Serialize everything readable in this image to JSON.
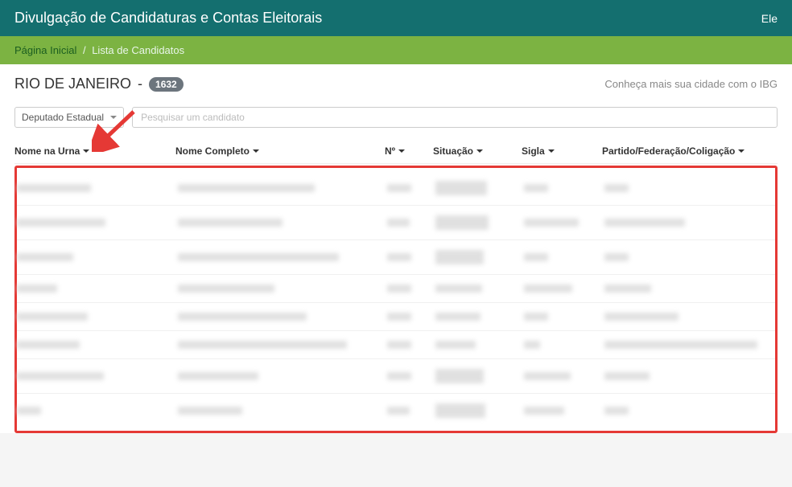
{
  "header": {
    "title": "Divulgação de Candidaturas e Contas Eleitorais",
    "right_link": "Ele"
  },
  "breadcrumb": {
    "home": "Página Inicial",
    "current": "Lista de Candidatos"
  },
  "region": {
    "name": "RIO DE JANEIRO",
    "dash": "-",
    "count": "1632"
  },
  "ibge_text": "Conheça mais sua cidade com o IBG",
  "filters": {
    "position_select": "Deputado Estadual",
    "search_placeholder": "Pesquisar um candidato"
  },
  "columns": {
    "nome_urna": "Nome na Urna",
    "nome_completo": "Nome Completo",
    "numero": "Nº",
    "situacao": "Situação",
    "sigla": "Sigla",
    "partido": "Partido/Federação/Coligação"
  },
  "rows": [
    {
      "w1": 92,
      "w2": 170,
      "w3": 30,
      "w4": 64,
      "w4h": "tall",
      "w5": 30,
      "w6": 30
    },
    {
      "w1": 110,
      "w2": 130,
      "w3": 28,
      "w4": 66,
      "w4h": "tall",
      "w5": 68,
      "w6": 100
    },
    {
      "w1": 70,
      "w2": 200,
      "w3": 30,
      "w4": 60,
      "w4h": "tall",
      "w5": 30,
      "w6": 30
    },
    {
      "w1": 50,
      "w2": 120,
      "w3": 30,
      "w4": 58,
      "w4h": "",
      "w5": 60,
      "w6": 58
    },
    {
      "w1": 88,
      "w2": 160,
      "w3": 30,
      "w4": 56,
      "w4h": "",
      "w5": 30,
      "w6": 92
    },
    {
      "w1": 78,
      "w2": 210,
      "w3": 30,
      "w4": 50,
      "w4h": "",
      "w5": 20,
      "w6": 190
    },
    {
      "w1": 108,
      "w2": 100,
      "w3": 30,
      "w4": 60,
      "w4h": "tall",
      "w5": 58,
      "w6": 56
    },
    {
      "w1": 30,
      "w2": 80,
      "w3": 28,
      "w4": 62,
      "w4h": "tall",
      "w5": 50,
      "w6": 30
    }
  ]
}
